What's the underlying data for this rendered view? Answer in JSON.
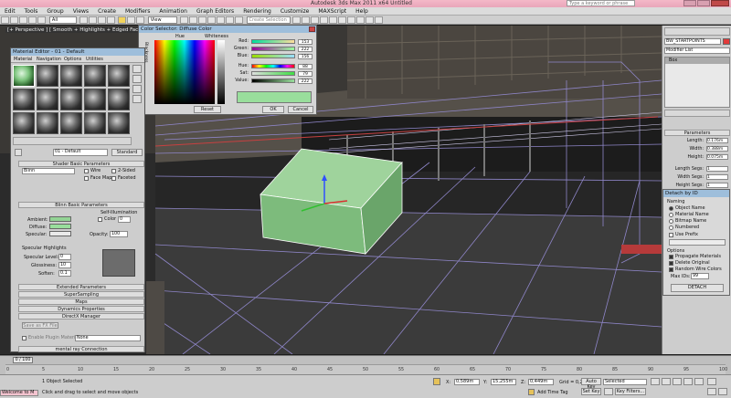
{
  "titlebar": {
    "title": "Autodesk 3ds Max 2011 x64   Untitled",
    "search_placeholder": "Type a keyword or phrase"
  },
  "menu": [
    "Edit",
    "Tools",
    "Group",
    "Views",
    "Create",
    "Modifiers",
    "Animation",
    "Graph Editors",
    "Rendering",
    "Customize",
    "MAXScript",
    "Help"
  ],
  "toolbar": {
    "filter": "All",
    "ref_coord": "View",
    "selection_set": "Create Selection Se"
  },
  "viewport": {
    "label": "[+ Perspective ] [ Smooth + Highlights + Edged Faces ]"
  },
  "color_dialog": {
    "title": "Color Selector: Diffuse Color",
    "hue_label": "Hue",
    "whiteness_label": "Whiteness",
    "blackness_label": "Blackness",
    "sliders": [
      {
        "label": "Red:",
        "value": "153"
      },
      {
        "label": "Green:",
        "value": "222"
      },
      {
        "label": "Blue:",
        "value": "156"
      },
      {
        "label": "Hue:",
        "value": "88"
      },
      {
        "label": "Sat:",
        "value": "79"
      },
      {
        "label": "Value:",
        "value": "222"
      }
    ],
    "reset_label": "Reset",
    "ok_label": "OK",
    "cancel_label": "Cancel",
    "swatch_color": "#99de9c"
  },
  "material_editor": {
    "title": "Material Editor - 01 - Default",
    "menu": [
      "Material",
      "Navigation",
      "Options",
      "Utilities"
    ],
    "material_name": "01 - Default",
    "material_type": "Standard",
    "rollouts": {
      "shader_basic": "Shader Basic Parameters",
      "shader": "Blinn",
      "wire": "Wire",
      "two_sided": "2-Sided",
      "face_map": "Face Map",
      "faceted": "Faceted",
      "blinn_basic": "Blinn Basic Parameters",
      "self_illum": "Self-Illumination",
      "color_label": "Color",
      "color_value": "0",
      "ambient": "Ambient:",
      "diffuse": "Diffuse:",
      "specular": "Specular:",
      "opacity_label": "Opacity:",
      "opacity_value": "100",
      "spec_highlights": "Specular Highlights",
      "spec_level": "Specular Level:",
      "spec_level_value": "0",
      "glossiness": "Glossiness:",
      "glossiness_value": "10",
      "soften": "Soften:",
      "soften_value": "0.1",
      "extended": "Extended Parameters",
      "supersampling": "SuperSampling",
      "maps": "Maps",
      "dynamics": "Dynamics Properties",
      "directx": "DirectX Manager",
      "save_fx": "Save as FX File",
      "enable_plugin": "Enable Plugin Material",
      "plugin_value": "None",
      "mental_ray": "mental ray Connection"
    }
  },
  "command_panel": {
    "object_name": "BW_STARTPOINTS",
    "modifier_list": "Modifier List",
    "stack_item": "Box",
    "parameters_title": "Parameters",
    "params": [
      {
        "label": "Length:",
        "value": "0.176m"
      },
      {
        "label": "Width:",
        "value": "0.388m"
      },
      {
        "label": "Height:",
        "value": "0.075m"
      },
      {
        "label": "Length Segs:",
        "value": "1"
      },
      {
        "label": "Width Segs:",
        "value": "1"
      },
      {
        "label": "Height Segs:",
        "value": "1"
      }
    ]
  },
  "detach_dialog": {
    "title": "Detach by ID",
    "naming": "Naming",
    "options_naming": [
      "Object Name",
      "Material Name",
      "Bitmap Name",
      "Numbered"
    ],
    "use_prefix": "Use Prefix",
    "options_title": "Options",
    "options": [
      "Propagate Materials",
      "Delete Original",
      "Random Wire Colors"
    ],
    "max_ids_label": "Max IDs:",
    "max_ids_value": "99",
    "detach_button": "DETACH"
  },
  "timeline": {
    "frame_counter": "0 / 100",
    "ticks": [
      "0",
      "5",
      "10",
      "15",
      "20",
      "25",
      "30",
      "35",
      "40",
      "45",
      "50",
      "55",
      "60",
      "65",
      "70",
      "75",
      "80",
      "85",
      "90",
      "95",
      "100"
    ]
  },
  "status": {
    "selection": "1 Object Selected",
    "prompt": "Click and drag to select and move objects",
    "listener": "Welcome to M",
    "x_label": "X:",
    "x_value": "0,589m",
    "y_label": "Y:",
    "y_value": "15,255m",
    "z_label": "Z:",
    "z_value": "0,449m",
    "grid": "Grid = 0,254m",
    "add_time_tag": "Add Time Tag",
    "auto_key": "Auto Key",
    "set_key": "Set Key",
    "selected": "Selected",
    "key_filters": "Key Filters..."
  }
}
